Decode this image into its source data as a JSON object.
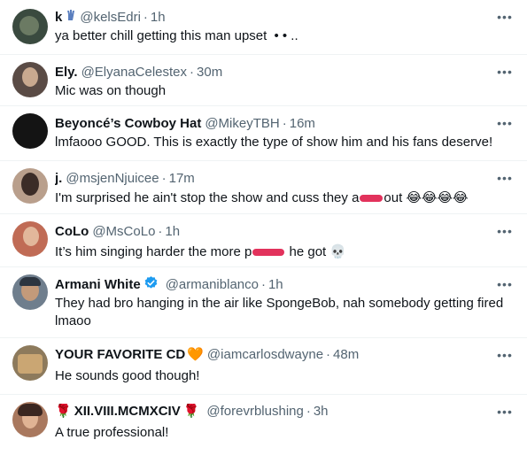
{
  "replies": [
    {
      "name": "k",
      "handle": "@kelsEdri",
      "time": "1h",
      "text": "ya better chill getting this man upset",
      "suffix": "• • ..",
      "avatar_color": "#3a4a3f"
    },
    {
      "name": "Ely.",
      "handle": "@ElyanaCelestex",
      "time": "30m",
      "text": "Mic was on though",
      "avatar_color": "#5a4b45"
    },
    {
      "name": "Beyoncé’s Cowboy Hat",
      "handle": "@MikeyTBH",
      "time": "16m",
      "text": "lmfaooo GOOD. This is exactly the type of show him and his fans deserve!",
      "avatar_color": "#141414"
    },
    {
      "name": "j.",
      "handle": "@msjenNjuicee",
      "time": "17m",
      "text_before": "I'm surprised he ain't stop the show and cuss they a",
      "text_after": "out",
      "emoji": "😂😂😂😂",
      "avatar_color": "#b99f8c"
    },
    {
      "name": "CoLo",
      "handle": "@MsCoLo",
      "time": "1h",
      "text_before": "It’s him singing harder the more p",
      "text_after": "he got",
      "emoji": "💀",
      "avatar_color": "#c06b55"
    },
    {
      "name": "Armani White",
      "handle": "@armaniblanco",
      "time": "1h",
      "text": "They had bro hanging in the air like SpongeBob, nah somebody getting fired lmaoo",
      "avatar_color": "#6f7e8d"
    },
    {
      "name": "YOUR FAVORITE CD",
      "name_emoji": "🧡",
      "handle": "@iamcarlosdwayne",
      "time": "48m",
      "text": "He sounds good though!",
      "avatar_color": "#8d7a5c"
    },
    {
      "name": "XII.VIII.MCMXCIV",
      "name_emoji_before": "🌹",
      "name_emoji_after": "🌹",
      "handle": "@forevrblushing",
      "time": "3h",
      "text": "A true professional!",
      "avatar_color": "#a9785e"
    }
  ],
  "separator": "·",
  "more_glyph": "•••"
}
